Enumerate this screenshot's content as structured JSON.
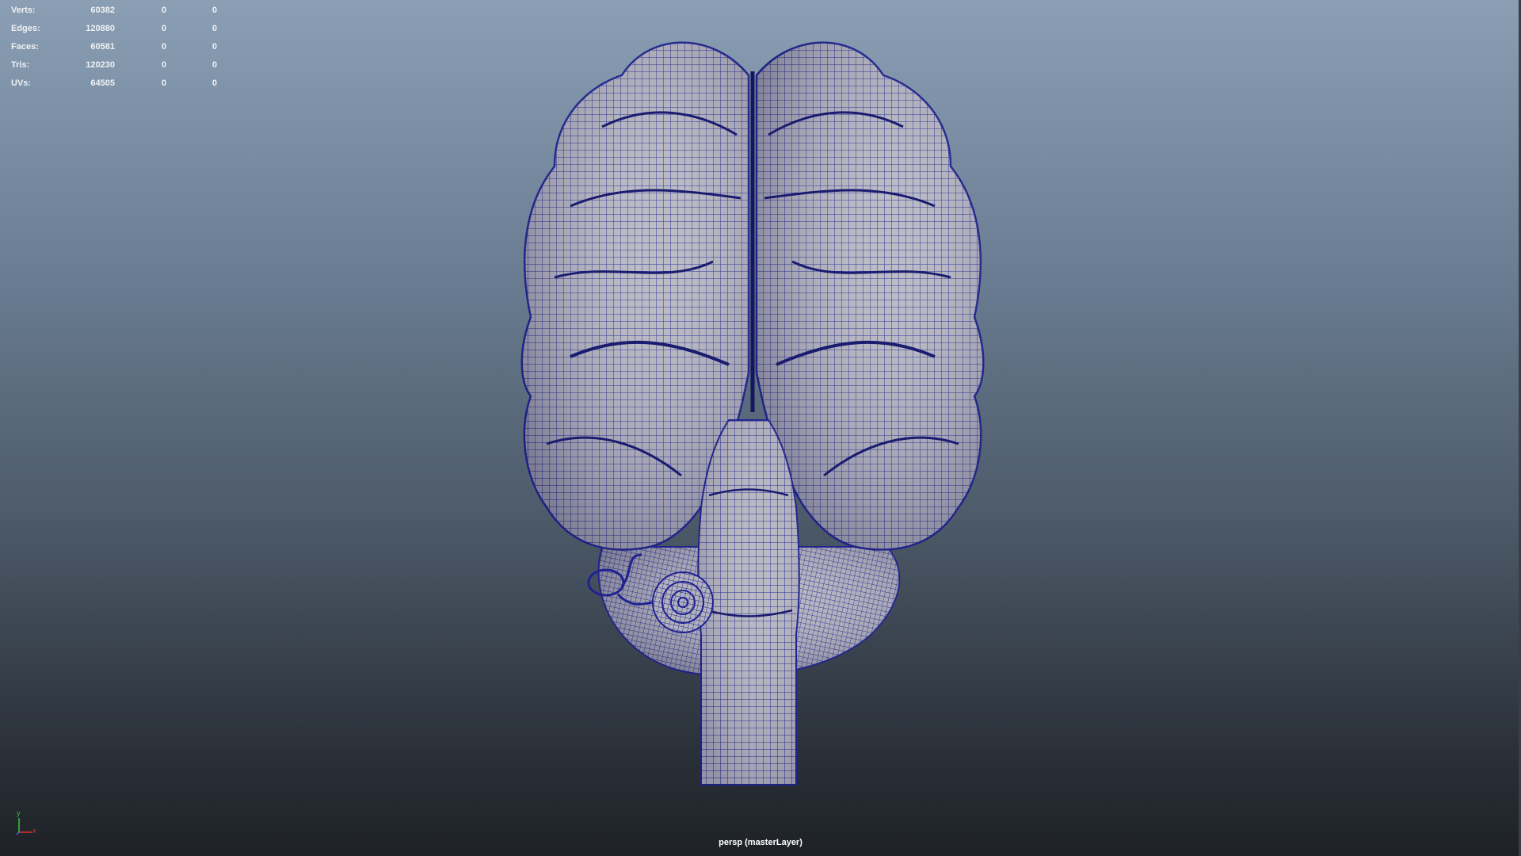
{
  "hud": {
    "rows": [
      {
        "label": "Verts:",
        "value": "60382",
        "selected": "0",
        "uv": "0"
      },
      {
        "label": "Edges:",
        "value": "120880",
        "selected": "0",
        "uv": "0"
      },
      {
        "label": "Faces:",
        "value": "60581",
        "selected": "0",
        "uv": "0"
      },
      {
        "label": "Tris:",
        "value": "120230",
        "selected": "0",
        "uv": "0"
      },
      {
        "label": "UVs:",
        "value": "64505",
        "selected": "0",
        "uv": "0"
      }
    ]
  },
  "camera": {
    "label": "persp (masterLayer)"
  },
  "gizmo": {
    "y": "y",
    "x": "x"
  },
  "colors": {
    "wire": "#1c1f8a",
    "surface": "#b6b6c0",
    "text": "#f0f2f4"
  }
}
